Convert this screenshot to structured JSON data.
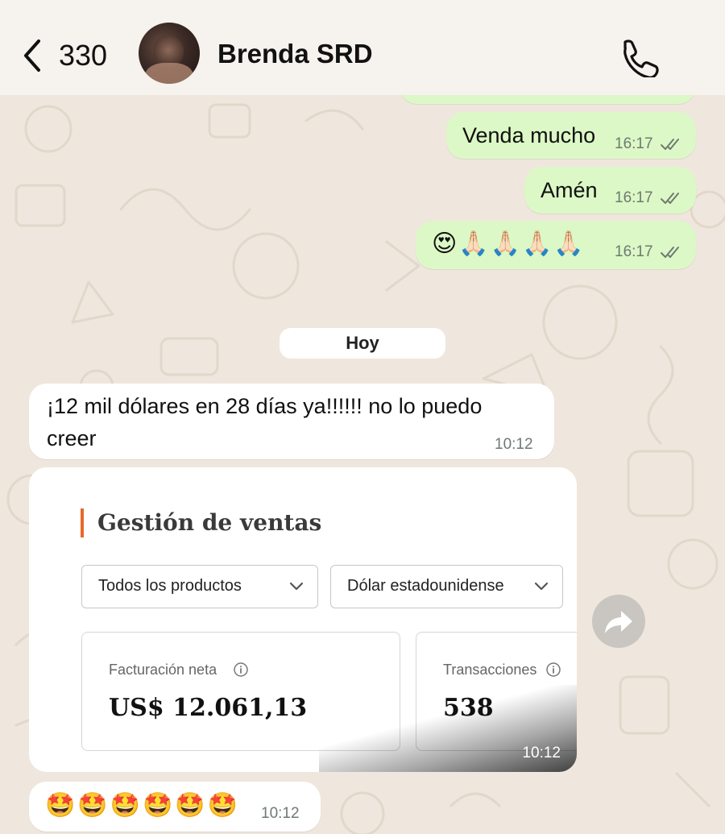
{
  "header": {
    "back_count": "330",
    "contact_name": "Brenda SRD"
  },
  "messages": [
    {
      "text": "Venda mucho",
      "time": "16:17"
    },
    {
      "text": "Amén",
      "time": "16:17"
    },
    {
      "text": "😍🙏🏻🙏🏻🙏🏻🙏🏻",
      "time": "16:17"
    }
  ],
  "date_separator": "Hoy",
  "incoming": {
    "line1": "¡12 mil dólares en 28 días ya!!!!!! no lo puedo",
    "line2": "creer",
    "time": "10:12"
  },
  "card": {
    "title": "Gestión de ventas",
    "select_products": "Todos los productos",
    "select_currency": "Dólar estadounidense",
    "metric1_label": "Facturación neta",
    "metric1_value": "US$ 12.061,13",
    "metric2_label": "Transacciones",
    "metric2_value": "538",
    "time": "10:12"
  },
  "emoji_message": {
    "text": "🤩🤩🤩🤩🤩🤩",
    "time": "10:12"
  },
  "colors": {
    "outgoing_bubble": "#dcf8c6",
    "incoming_bubble": "#ffffff",
    "accent_bar": "#e66a2c",
    "background": "#efe7dd"
  }
}
